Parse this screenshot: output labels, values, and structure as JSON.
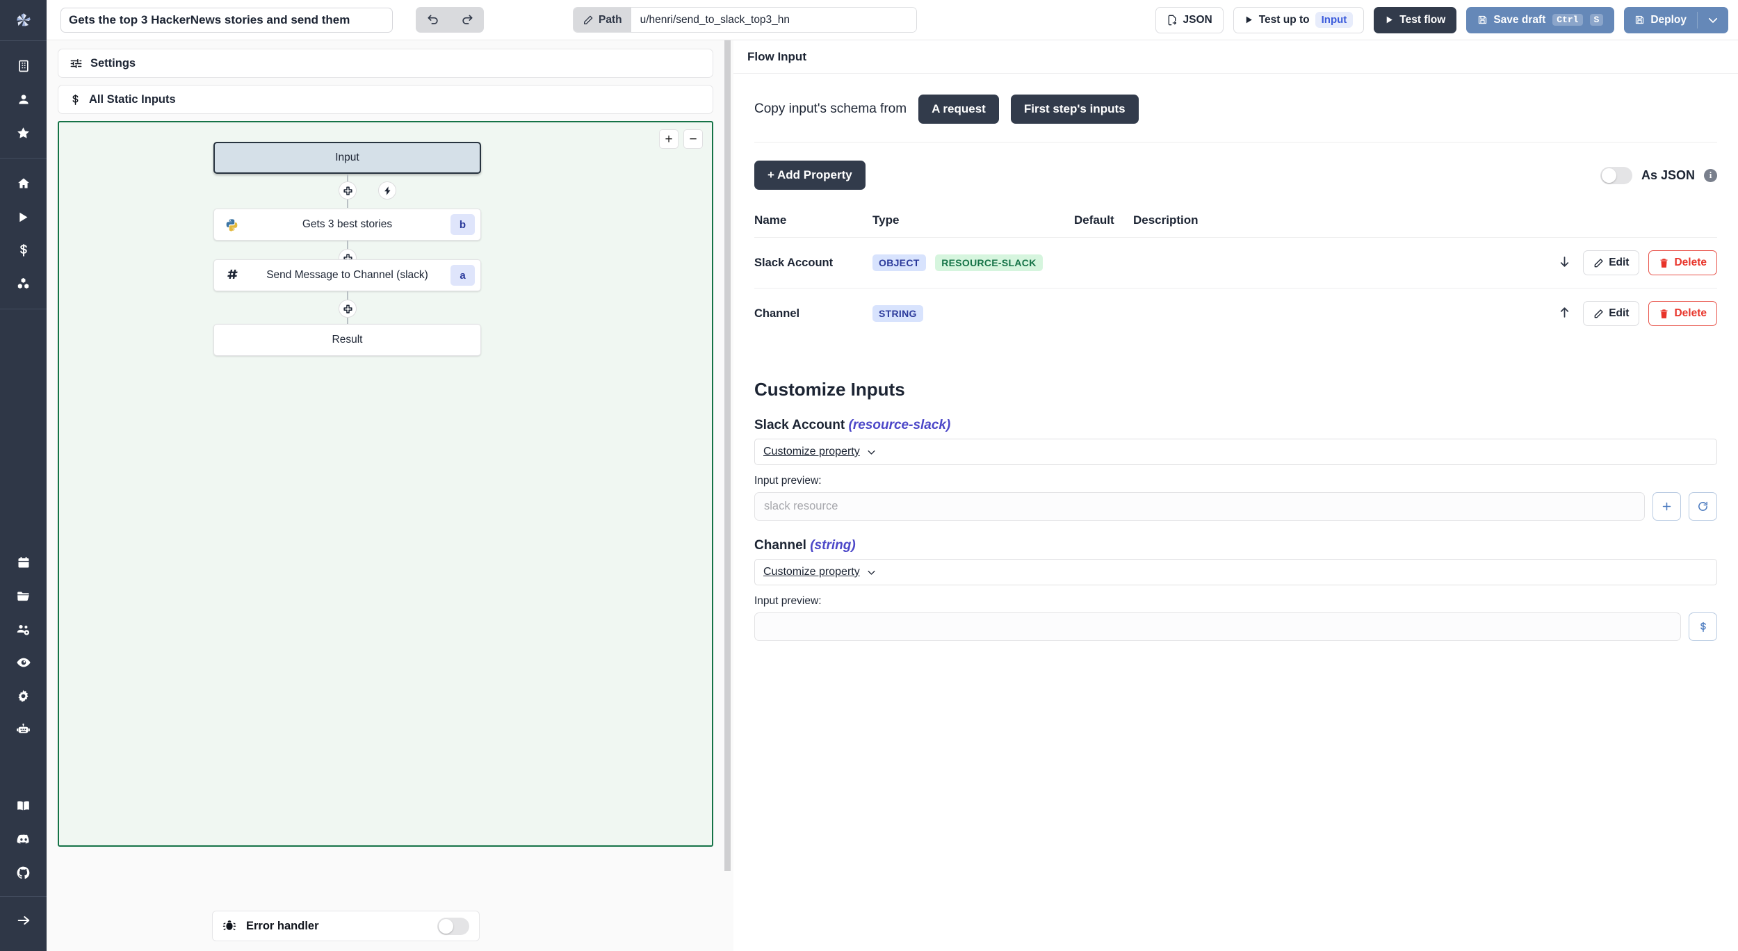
{
  "app": {
    "logo_icon": "windmill-logo-icon"
  },
  "sidebar": {
    "groups": [
      {
        "items": [
          {
            "icon": "building-icon",
            "name": "workspace"
          },
          {
            "icon": "user-icon",
            "name": "user"
          },
          {
            "icon": "star-icon",
            "name": "favorites"
          }
        ]
      },
      {
        "items": [
          {
            "icon": "home-icon",
            "name": "home"
          },
          {
            "icon": "play-icon",
            "name": "runs"
          },
          {
            "icon": "dollar-icon",
            "name": "variables"
          },
          {
            "icon": "resources-icon",
            "name": "resources"
          }
        ]
      },
      {
        "items": [
          {
            "icon": "calendar-icon",
            "name": "schedules"
          },
          {
            "icon": "folder-icon",
            "name": "folders"
          },
          {
            "icon": "groups-icon",
            "name": "groups"
          },
          {
            "icon": "eye-icon",
            "name": "audit-logs"
          },
          {
            "icon": "gear-icon",
            "name": "settings"
          },
          {
            "icon": "robot-icon",
            "name": "workers"
          }
        ]
      },
      {
        "items": [
          {
            "icon": "book-icon",
            "name": "docs"
          },
          {
            "icon": "discord-icon",
            "name": "discord"
          },
          {
            "icon": "github-icon",
            "name": "github"
          }
        ]
      },
      {
        "items": [
          {
            "icon": "arrow-right-icon",
            "name": "expand-sidebar"
          }
        ]
      }
    ]
  },
  "topbar": {
    "flow_title": "Gets the top 3 HackerNews stories and send them",
    "undo_icon": "undo-icon",
    "redo_icon": "redo-icon",
    "path_label": "Path",
    "path_value": "u/henri/send_to_slack_top3_hn",
    "json_label": "JSON",
    "test_up_to_label": "Test up to",
    "test_up_to_target": "Input",
    "test_flow_label": "Test flow",
    "save_draft_label": "Save draft",
    "save_draft_key1": "Ctrl",
    "save_draft_key2": "S",
    "deploy_label": "Deploy"
  },
  "left_panel": {
    "settings_label": "Settings",
    "static_inputs_label": "All Static Inputs",
    "zoom_in": "+",
    "zoom_out": "−",
    "flow": {
      "nodes": [
        {
          "label": "Input",
          "icon": null,
          "badge": null,
          "selected": true
        },
        {
          "label": "Gets 3 best stories",
          "icon": "python-icon",
          "badge": "b",
          "selected": false
        },
        {
          "label": "Send Message to Channel (slack)",
          "icon": "slack-icon",
          "badge": "a",
          "selected": false
        },
        {
          "label": "Result",
          "icon": null,
          "badge": null,
          "selected": false
        }
      ]
    },
    "error_handler": {
      "label": "Error handler",
      "icon": "bug-icon",
      "enabled": false
    }
  },
  "right_panel": {
    "header_title": "Flow Input",
    "copy_schema_label": "Copy input's schema from",
    "copy_from_request": "A request",
    "copy_from_first_step": "First step's inputs",
    "add_property_label": "+ Add Property",
    "as_json_label": "As JSON",
    "as_json_enabled": false,
    "info_icon": "info-icon",
    "table": {
      "headers": [
        "Name",
        "Type",
        "Default",
        "Description"
      ],
      "rows": [
        {
          "name": "Slack Account",
          "types": [
            {
              "text": "OBJECT",
              "color": "blue"
            },
            {
              "text": "RESOURCE-SLACK",
              "color": "green"
            }
          ],
          "default": "",
          "description": "",
          "move_icon": "arrow-down-icon",
          "edit_label": "Edit",
          "delete_label": "Delete"
        },
        {
          "name": "Channel",
          "types": [
            {
              "text": "STRING",
              "color": "blue"
            }
          ],
          "default": "",
          "description": "",
          "move_icon": "arrow-up-icon",
          "edit_label": "Edit",
          "delete_label": "Delete"
        }
      ]
    },
    "customize": {
      "title": "Customize Inputs",
      "fields": [
        {
          "name": "Slack Account",
          "type": "(resource-slack)",
          "customize_label": "Customize property",
          "preview_label": "Input preview:",
          "preview_value": "",
          "preview_placeholder": "slack resource",
          "buttons": [
            "plus-icon",
            "refresh-icon"
          ]
        },
        {
          "name": "Channel",
          "type": "(string)",
          "customize_label": "Customize property",
          "preview_label": "Input preview:",
          "preview_value": "",
          "preview_placeholder": "",
          "buttons": [
            "dollar-icon"
          ]
        }
      ]
    }
  },
  "colors": {
    "accent_dark": "#323b4b",
    "accent_blue": "#6588b8",
    "canvas_border_green": "#157347",
    "danger": "#e8342a",
    "tag_blue_bg": "#d8e3fd",
    "tag_green_bg": "#d6f5de"
  }
}
